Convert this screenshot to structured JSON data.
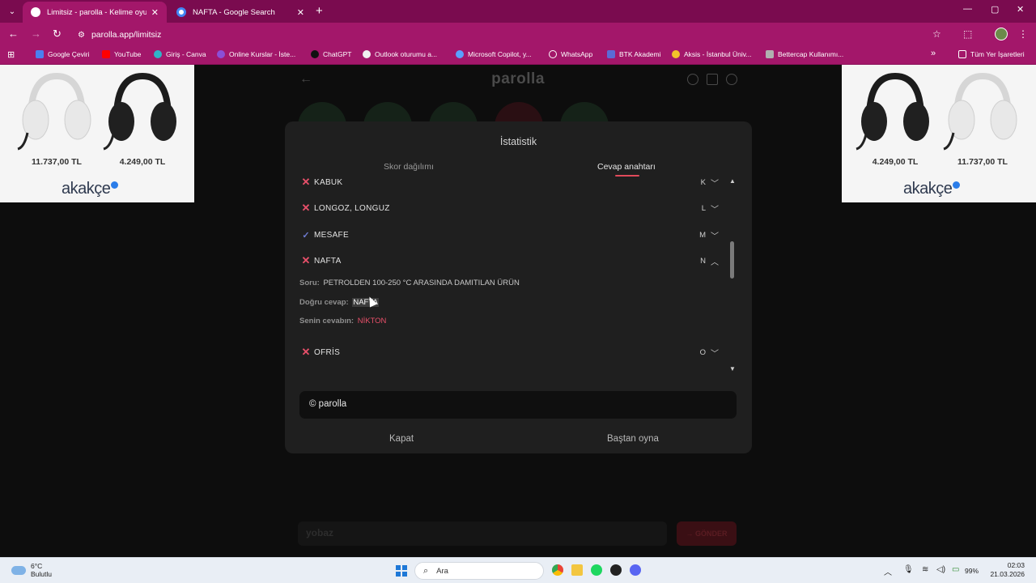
{
  "browser": {
    "tabs": [
      {
        "title": "Limitsiz - parolla - Kelime oyunu",
        "active": true
      },
      {
        "title": "NAFTA - Google Search",
        "active": false
      }
    ],
    "url": "parolla.app/limitsiz",
    "new_tab_label": "+",
    "window_controls": {
      "minimize": "—",
      "maximize": "▢",
      "close": "✕"
    }
  },
  "bookmarks": [
    {
      "label": "Google Çeviri",
      "color": "#4a80f0"
    },
    {
      "label": "YouTube",
      "color": "#ff0000"
    },
    {
      "label": "Giriş - Canva",
      "color": "#2fb3c8"
    },
    {
      "label": "Online Kurslar - İste...",
      "color": "#8b4fd6"
    },
    {
      "label": "ChatGPT",
      "color": "#111111"
    },
    {
      "label": "Outlook oturumu a...",
      "color": "#f0f0f0"
    },
    {
      "label": "Microsoft Copilot, y...",
      "color": "#5aa0ff"
    },
    {
      "label": "WhatsApp",
      "color": "#ffffff"
    },
    {
      "label": "BTK Akademi",
      "color": "#5b6bd6"
    },
    {
      "label": "Aksis - İstanbul Üniv...",
      "color": "#f2c22a"
    },
    {
      "label": "Bettercap Kullanımı...",
      "color": "#b0b0b0"
    }
  ],
  "bookmarks_more": "»",
  "all_bookmarks": "Tüm Yer İşaretleri",
  "ads": {
    "left": {
      "prices": [
        "11.737,00 TL",
        "4.249,00 TL"
      ],
      "brand": "akakçe"
    },
    "right": {
      "prices": [
        "4.249,00 TL",
        "11.737,00 TL"
      ],
      "brand": "akakçe"
    }
  },
  "game": {
    "logo": "parolla",
    "input_placeholder": "yobaz",
    "send_label": "→ GÖNDER"
  },
  "modal": {
    "title": "İstatistik",
    "tabs": [
      "Skor dağılımı",
      "Cevap anahtarı"
    ],
    "active_tab": 1,
    "answers": [
      {
        "word": "KABUK",
        "letter": "K",
        "status": "wrong",
        "expanded": false
      },
      {
        "word": "LONGOZ, LONGUZ",
        "letter": "L",
        "status": "wrong",
        "expanded": false
      },
      {
        "word": "MESAFE",
        "letter": "M",
        "status": "correct",
        "expanded": false
      },
      {
        "word": "NAFTA",
        "letter": "N",
        "status": "wrong",
        "expanded": true
      },
      {
        "word": "OFRİS",
        "letter": "O",
        "status": "wrong",
        "expanded": false
      }
    ],
    "detail": {
      "question_label": "Soru:",
      "question": "PETROLDEN 100-250 °C ARASINDA DAMITILAN ÜRÜN",
      "correct_label": "Doğru cevap:",
      "correct": "NAFTA",
      "yours_label": "Senin cevabın:",
      "yours": "NİKTON"
    },
    "copyright": "© parolla",
    "buttons": {
      "close": "Kapat",
      "restart": "Baştan oyna"
    }
  },
  "taskbar": {
    "weather_temp": "6°C",
    "weather_desc": "Bulutlu",
    "search_placeholder": "Ara",
    "battery": "99%",
    "time": "02:03",
    "date": "21.03.2026"
  }
}
